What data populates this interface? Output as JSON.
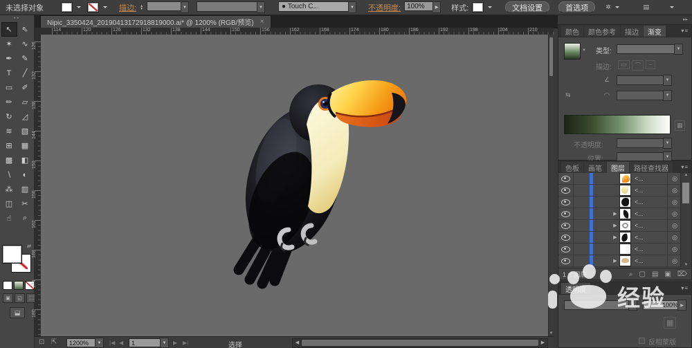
{
  "control_bar": {
    "selection_status": "未选择对象",
    "stroke_label": "描边:",
    "touch_preset_value": "Touch C...",
    "opacity_label": "不透明度:",
    "opacity_value": "100%",
    "style_label": "样式:",
    "document_setup_button": "文档设置",
    "preferences_button": "首选项"
  },
  "document_tab": {
    "title": "Nipic_3350424_20190413172918819000.ai* @ 1200% (RGB/预览)",
    "close_glyph": "×"
  },
  "toolbar": {
    "fill_color": "#ffffff",
    "stroke_color": "none",
    "tools": [
      {
        "name": "selection",
        "glyph": "↖",
        "active": true
      },
      {
        "name": "direct-selection",
        "glyph": "⇖",
        "active": false
      },
      {
        "name": "magic-wand",
        "glyph": "✶",
        "active": false
      },
      {
        "name": "lasso",
        "glyph": "∿",
        "active": false
      },
      {
        "name": "pen",
        "glyph": "✒",
        "active": false
      },
      {
        "name": "curvature",
        "glyph": "✎",
        "active": false
      },
      {
        "name": "type",
        "glyph": "T",
        "active": false
      },
      {
        "name": "line-segment",
        "glyph": "╱",
        "active": false
      },
      {
        "name": "rectangle",
        "glyph": "▭",
        "active": false
      },
      {
        "name": "paintbrush",
        "glyph": "✐",
        "active": false
      },
      {
        "name": "pencil",
        "glyph": "✏",
        "active": false
      },
      {
        "name": "eraser",
        "glyph": "▱",
        "active": false
      },
      {
        "name": "rotate",
        "glyph": "↻",
        "active": false
      },
      {
        "name": "scale",
        "glyph": "◿",
        "active": false
      },
      {
        "name": "width",
        "glyph": "≋",
        "active": false
      },
      {
        "name": "free-transform",
        "glyph": "▧",
        "active": false
      },
      {
        "name": "shape-builder",
        "glyph": "⊞",
        "active": false
      },
      {
        "name": "perspective-grid",
        "glyph": "▦",
        "active": false
      },
      {
        "name": "mesh",
        "glyph": "▩",
        "active": false
      },
      {
        "name": "gradient",
        "glyph": "◧",
        "active": false
      },
      {
        "name": "eyedropper",
        "glyph": "∖",
        "active": false
      },
      {
        "name": "blend",
        "glyph": "◐",
        "active": false
      },
      {
        "name": "symbol-sprayer",
        "glyph": "⁂",
        "active": false
      },
      {
        "name": "column-graph",
        "glyph": "▥",
        "active": false
      },
      {
        "name": "artboard",
        "glyph": "◫",
        "active": false
      },
      {
        "name": "slice",
        "glyph": "✂",
        "active": false
      },
      {
        "name": "hand",
        "glyph": "☝",
        "active": false
      },
      {
        "name": "zoom",
        "glyph": "⌕",
        "active": false
      }
    ]
  },
  "canvas": {
    "h_ruler": [
      "114",
      "120",
      "126",
      "132",
      "138",
      "144",
      "150",
      "156",
      "162",
      "168",
      "174",
      "180",
      "186",
      "192",
      "198",
      "204",
      "210"
    ],
    "v_ruler": [
      "126",
      "132",
      "138",
      "144",
      "150",
      "156",
      "162",
      "168",
      "174",
      "180"
    ],
    "artwork": {
      "subject": "toucan illustration",
      "body_color": "#121212",
      "chest_color": "#f7f1cf",
      "beak_yellow": "#ffd84d",
      "beak_orange": "#f39113",
      "beak_lower": "#d9531e",
      "beak_tip": "#1a1a1a",
      "eye_ring": "#e07a1e",
      "eye_color": "#232d66",
      "feet_color": "#c8c8c8",
      "background": "#6a6a6a"
    }
  },
  "panels": {
    "gradient": {
      "tabs": [
        {
          "label": "颜色",
          "active": false
        },
        {
          "label": "颜色参考",
          "active": false
        },
        {
          "label": "描边",
          "active": false
        },
        {
          "label": "渐变",
          "active": true
        }
      ],
      "type_label": "类型:",
      "stroke_row_label": "描边:",
      "opacity_label": "不透明度:",
      "location_label": "位置:",
      "gradient_stops": [
        "#1c2416",
        "#7a9671",
        "#ffffff"
      ]
    },
    "layers": {
      "tabs": [
        {
          "label": "色板",
          "active": false
        },
        {
          "label": "画笔",
          "active": false
        },
        {
          "label": "图层",
          "active": true
        },
        {
          "label": "路径查找器",
          "active": false
        }
      ],
      "rows": [
        {
          "label": "<...",
          "thumb": "beak",
          "expandable": false
        },
        {
          "label": "<...",
          "thumb": "chest",
          "expandable": false
        },
        {
          "label": "<...",
          "thumb": "bird",
          "expandable": false
        },
        {
          "label": "<...",
          "thumb": "wing",
          "expandable": true
        },
        {
          "label": "<...",
          "thumb": "feet",
          "expandable": true
        },
        {
          "label": "<...",
          "thumb": "feather",
          "expandable": true
        },
        {
          "label": "<...",
          "thumb": "white",
          "expandable": false
        },
        {
          "label": "<...",
          "thumb": "tan",
          "expandable": true
        }
      ],
      "count_status": "1 个图层",
      "action_icons": [
        {
          "name": "locate-object-icon",
          "glyph": "⌕"
        },
        {
          "name": "clip-mask-icon",
          "glyph": "▢"
        },
        {
          "name": "new-sublayer-icon",
          "glyph": "▤"
        },
        {
          "name": "new-layer-icon",
          "glyph": "▣"
        },
        {
          "name": "delete-layer-icon",
          "glyph": "⌦"
        }
      ],
      "selection_color": "#3f6fd0"
    },
    "transparency": {
      "title": "透明度",
      "opacity_value": "100%",
      "invert_mask_label": "反相蒙版"
    }
  },
  "status_bar": {
    "zoom_value": "1200%",
    "artboard_value": "1",
    "mode_label": "选择"
  },
  "watermark": {
    "brand_text": "经验"
  }
}
